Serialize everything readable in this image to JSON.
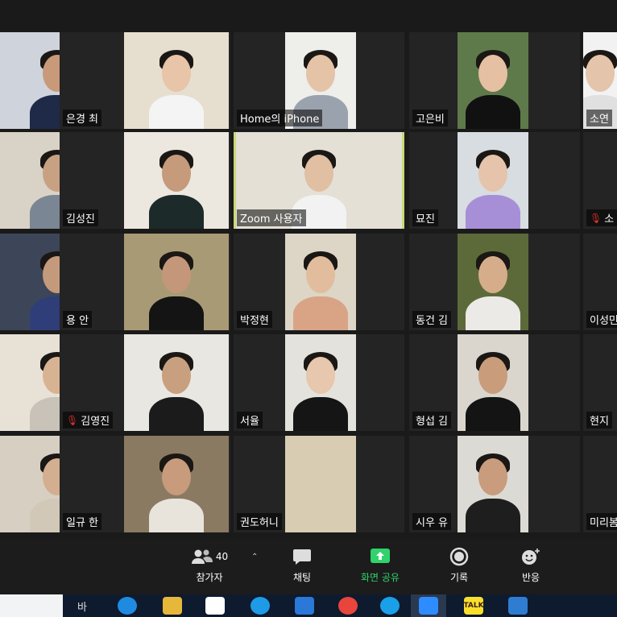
{
  "tiles": [
    {
      "name": "",
      "mute": false,
      "bg": "#cfd4dc",
      "skin": "#c89a7a",
      "shirt": "#1e2a48"
    },
    {
      "name": "은경 최",
      "mute": false,
      "bg": "#e6dfcf",
      "skin": "#e8c4a8",
      "shirt": "#f4f4f4"
    },
    {
      "name": "Home의 iPhone",
      "mute": false,
      "bg": "#eeeeea",
      "skin": "#e5c3a7",
      "shirt": "#9aa3ad"
    },
    {
      "name": "고은비",
      "mute": false,
      "bg": "#5e7a4a",
      "skin": "#e6c0a2",
      "shirt": "#111111"
    },
    {
      "name": "소연",
      "mute": false,
      "bg": "#f2f2f2",
      "skin": "#e4c5ab",
      "shirt": "#e0e0e0"
    },
    {
      "name": "",
      "mute": false,
      "bg": "#d9d2c6",
      "skin": "#c8a183",
      "shirt": "#7b8694"
    },
    {
      "name": "김성진",
      "mute": false,
      "bg": "#ece8e0",
      "skin": "#c59b7b",
      "shirt": "#1d2a2a"
    },
    {
      "name": "Zoom 사용자",
      "mute": false,
      "bg": "#e4e0d6",
      "skin": "#e0bfa2",
      "shirt": "#f2f2f2"
    },
    {
      "name": "묘진",
      "mute": false,
      "bg": "#d7dde0",
      "skin": "#e5c4ab",
      "shirt": "#a78fd8"
    },
    {
      "name": "소",
      "mute": true,
      "bg": "#242424",
      "skin": "",
      "shirt": ""
    },
    {
      "name": "",
      "mute": false,
      "bg": "#3c4658",
      "skin": "#c49a7c",
      "shirt": "#2f3e78"
    },
    {
      "name": "용 안",
      "mute": false,
      "bg": "#a99a76",
      "skin": "#c4977a",
      "shirt": "#141414"
    },
    {
      "name": "박정현",
      "mute": false,
      "bg": "#ddd6c6",
      "skin": "#e2bd9d",
      "shirt": "#d9a486"
    },
    {
      "name": "동건 김",
      "mute": false,
      "bg": "#5c6a3a",
      "skin": "#d6ad8b",
      "shirt": "#eceae6"
    },
    {
      "name": "이성민",
      "mute": false,
      "bg": "#242424",
      "skin": "",
      "shirt": ""
    },
    {
      "name": "",
      "mute": false,
      "bg": "#e8e1d6",
      "skin": "#d8b393",
      "shirt": "#c9c2b8"
    },
    {
      "name": "김영진",
      "mute": true,
      "bg": "#e9e7e2",
      "skin": "#c9a07f",
      "shirt": "#1b1b1b"
    },
    {
      "name": "서율",
      "mute": false,
      "bg": "#e4e2dc",
      "skin": "#e7c7ad",
      "shirt": "#151515"
    },
    {
      "name": "형섭 김",
      "mute": false,
      "bg": "#dad6ce",
      "skin": "#c99c7c",
      "shirt": "#141414"
    },
    {
      "name": "현지",
      "mute": false,
      "bg": "#242424",
      "skin": "",
      "shirt": ""
    },
    {
      "name": "",
      "mute": false,
      "bg": "#d7cfc2",
      "skin": "#d4ae90",
      "shirt": "#d2c8b8"
    },
    {
      "name": "일규 한",
      "mute": false,
      "bg": "#8a7a62",
      "skin": "#c79b7b",
      "shirt": "#e8e4dc"
    },
    {
      "name": "권도허니",
      "mute": false,
      "bg": "#d8ccb2",
      "skin": "",
      "shirt": ""
    },
    {
      "name": "시우 유",
      "mute": false,
      "bg": "#dcdad4",
      "skin": "#c89c7c",
      "shirt": "#1e1e1e"
    },
    {
      "name": "미리봄",
      "mute": false,
      "bg": "#242424",
      "skin": "",
      "shirt": ""
    }
  ],
  "toolbar": {
    "participants_label": "참가자",
    "participants_count": "40",
    "chat_label": "채팅",
    "share_label": "화면 공유",
    "record_label": "기록",
    "reactions_label": "반응",
    "share_color": "#2fd36b"
  },
  "taskbar": {
    "ime_label": "바",
    "talk_label": "TALK"
  }
}
